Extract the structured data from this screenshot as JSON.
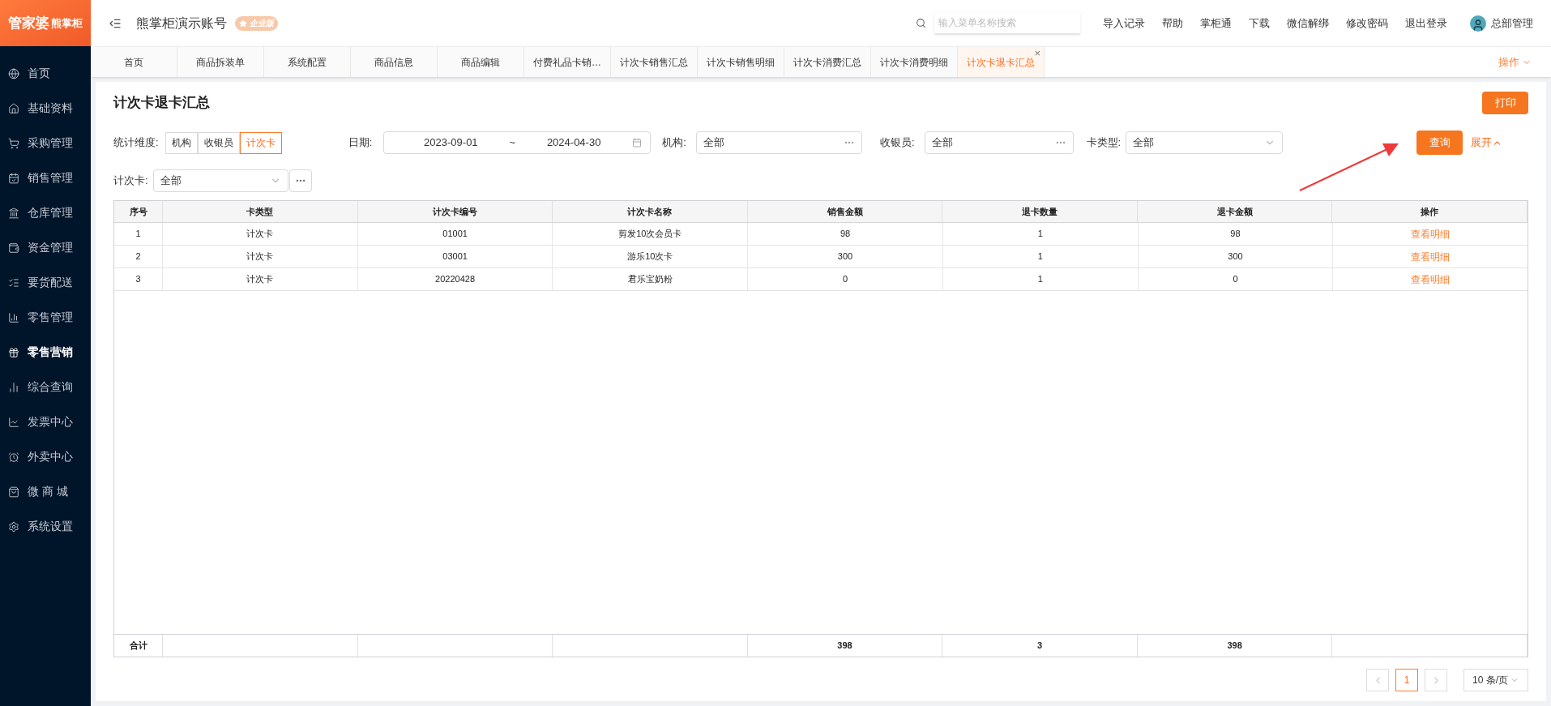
{
  "logo": {
    "brand": "管家婆",
    "sub": "熊掌柜"
  },
  "sidebar": {
    "items": [
      {
        "label": "首页",
        "selected": false
      },
      {
        "label": "基础资料",
        "selected": false
      },
      {
        "label": "采购管理",
        "selected": false
      },
      {
        "label": "销售管理",
        "selected": false
      },
      {
        "label": "仓库管理",
        "selected": false
      },
      {
        "label": "资金管理",
        "selected": false
      },
      {
        "label": "要货配送",
        "selected": false
      },
      {
        "label": "零售管理",
        "selected": false
      },
      {
        "label": "零售营销",
        "selected": true
      },
      {
        "label": "综合查询",
        "selected": false
      },
      {
        "label": "发票中心",
        "selected": false
      },
      {
        "label": "外卖中心",
        "selected": false
      },
      {
        "label": "微 商 城",
        "selected": false
      },
      {
        "label": "系统设置",
        "selected": false
      }
    ]
  },
  "header": {
    "account": "熊掌柜演示账号",
    "edition": "企业版",
    "search": {
      "placeholder": "输入菜单名称搜索"
    },
    "links": [
      "导入记录",
      "帮助",
      "掌柜通",
      "下载",
      "微信解绑",
      "修改密码",
      "退出登录"
    ],
    "user": "总部管理"
  },
  "tabs": [
    {
      "label": "首页",
      "selected": false
    },
    {
      "label": "商品拆装单",
      "selected": false
    },
    {
      "label": "系统配置",
      "selected": false
    },
    {
      "label": "商品信息",
      "selected": false
    },
    {
      "label": "商品编辑",
      "selected": false
    },
    {
      "label": "付费礼品卡销…",
      "selected": false
    },
    {
      "label": "计次卡销售汇总",
      "selected": false
    },
    {
      "label": "计次卡销售明细",
      "selected": false
    },
    {
      "label": "计次卡消费汇总",
      "selected": false
    },
    {
      "label": "计次卡消费明细",
      "selected": false
    },
    {
      "label": "计次卡退卡汇总",
      "selected": true
    }
  ],
  "tab_close": "×",
  "operations": "操作",
  "page": {
    "title": "计次卡退卡汇总",
    "print": "打印"
  },
  "filters": {
    "dimension": {
      "label": "统计维度:",
      "options": [
        {
          "label": "机构",
          "selected": false
        },
        {
          "label": "收银员",
          "selected": false
        },
        {
          "label": "计次卡",
          "selected": true
        }
      ]
    },
    "date": {
      "label": "日期:",
      "from": "2023-09-01",
      "sep": "~",
      "to": "2024-04-30"
    },
    "org": {
      "label": "机构:",
      "value": "全部"
    },
    "cashier": {
      "label": "收银员:",
      "value": "全部"
    },
    "card_type": {
      "label": "卡类型:",
      "value": "全部"
    },
    "card": {
      "label": "计次卡:",
      "value": "全部"
    },
    "query": "查询",
    "expand": "展开"
  },
  "table": {
    "columns": [
      "序号",
      "卡类型",
      "计次卡编号",
      "计次卡名称",
      "销售金额",
      "退卡数量",
      "退卡金额",
      "操作"
    ],
    "rows": [
      [
        "1",
        "计次卡",
        "01001",
        "剪发10次会员卡",
        "98",
        "1",
        "98",
        "查看明细"
      ],
      [
        "2",
        "计次卡",
        "03001",
        "游乐10次卡",
        "300",
        "1",
        "300",
        "查看明细"
      ],
      [
        "3",
        "计次卡",
        "20220428",
        "君乐宝奶粉",
        "0",
        "1",
        "0",
        "查看明细"
      ]
    ],
    "footer": {
      "label": "合计",
      "sales_amount": "398",
      "refund_count": "3",
      "refund_amount": "398"
    }
  },
  "pagination": {
    "pages": [
      {
        "label": "1",
        "selected": true
      }
    ],
    "page_size": "10 条/页"
  }
}
